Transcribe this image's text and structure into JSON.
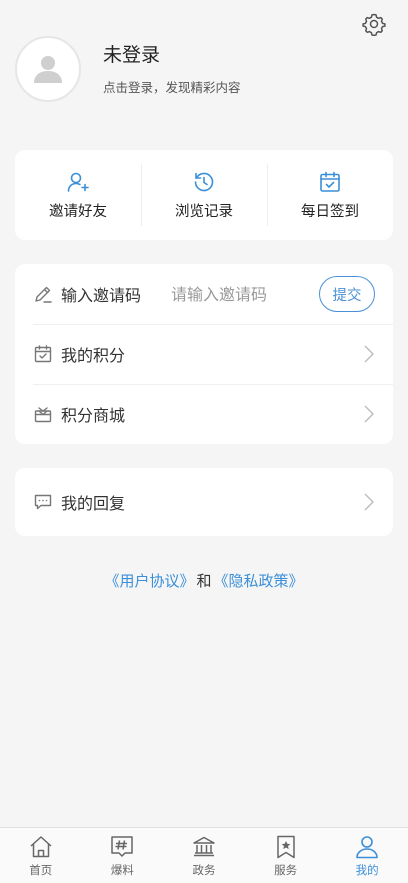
{
  "profile": {
    "name": "未登录",
    "subtitle": "点击登录，发现精彩内容"
  },
  "quick_actions": [
    {
      "label": "邀请好友",
      "icon": "user-add-icon"
    },
    {
      "label": "浏览记录",
      "icon": "history-icon"
    },
    {
      "label": "每日签到",
      "icon": "calendar-check-icon"
    }
  ],
  "menu": {
    "invite_label": "输入邀请码",
    "invite_placeholder": "请输入邀请码",
    "submit_label": "提交",
    "points_label": "我的积分",
    "mall_label": "积分商城"
  },
  "reply": {
    "label": "我的回复"
  },
  "agreement": {
    "user_agreement": "《用户协议》",
    "and": "和",
    "privacy_policy": "《隐私政策》"
  },
  "tabbar": [
    {
      "label": "首页",
      "icon": "home-icon"
    },
    {
      "label": "爆料",
      "icon": "hashtag-icon"
    },
    {
      "label": "政务",
      "icon": "government-icon"
    },
    {
      "label": "服务",
      "icon": "bookmark-star-icon"
    },
    {
      "label": "我的",
      "icon": "user-icon",
      "active": true
    }
  ],
  "colors": {
    "accent": "#3b8fd9",
    "background": "#f5f5f5"
  }
}
